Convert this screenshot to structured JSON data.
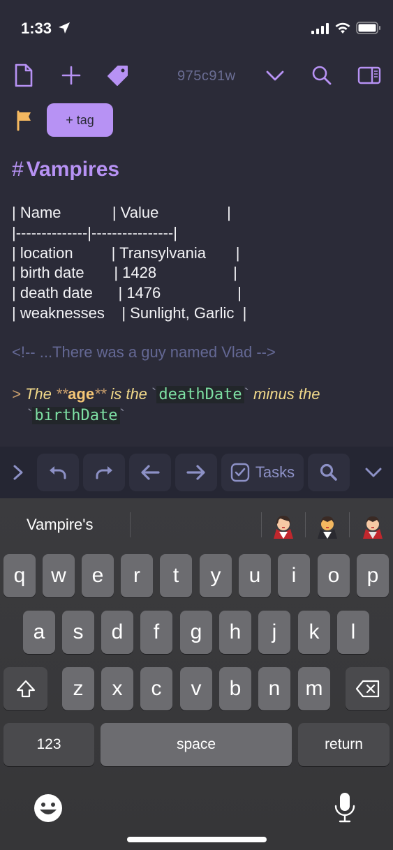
{
  "status": {
    "time": "1:33"
  },
  "toolbar": {
    "commit": "975c91w"
  },
  "tags": {
    "add_label": "+ tag"
  },
  "editor": {
    "heading_hash": "#",
    "heading": "Vampires",
    "table_lines": [
      "| Name            | Value                |",
      "|--------------|----------------|",
      "| location         | Transylvania       |",
      "| birth date       | 1428                  |",
      "| death date      | 1476                  |",
      "| weaknesses    | Sunlight, Garlic  |"
    ],
    "comment": "<!-- ...There was a guy named Vlad -->",
    "quote": {
      "marker": ">",
      "pre": "The",
      "bold_open": "**",
      "bold_word": "age",
      "bold_close": "**",
      "mid": "is the",
      "code1": "deathDate",
      "mid2": "minus the",
      "code2": "birthDate",
      "tick": "`"
    }
  },
  "accessory": {
    "tasks_label": "Tasks"
  },
  "keyboard": {
    "suggestion": "Vampire's",
    "row1": [
      "q",
      "w",
      "e",
      "r",
      "t",
      "y",
      "u",
      "i",
      "o",
      "p"
    ],
    "row2": [
      "a",
      "s",
      "d",
      "f",
      "g",
      "h",
      "j",
      "k",
      "l"
    ],
    "row3": [
      "z",
      "x",
      "c",
      "v",
      "b",
      "n",
      "m"
    ],
    "numbers_label": "123",
    "space_label": "space",
    "return_label": "return"
  }
}
